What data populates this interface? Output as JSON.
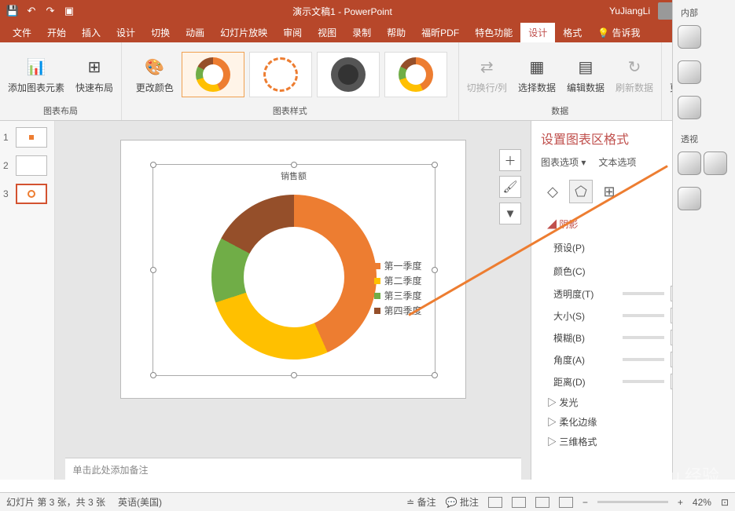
{
  "title": "演示文稿1 - PowerPoint",
  "user": "YuJiangLi",
  "tabs": {
    "file": "文件",
    "home": "开始",
    "insert": "插入",
    "design": "设计",
    "trans": "切换",
    "anim": "动画",
    "slideshow": "幻灯片放映",
    "review": "审阅",
    "view": "视图",
    "record": "录制",
    "help": "帮助",
    "foxit": "福昕PDF",
    "special": "特色功能",
    "chartdesign": "设计",
    "format": "格式",
    "tell": "告诉我"
  },
  "ribbon": {
    "group1": {
      "add": "添加图表元素",
      "quick": "快速布局",
      "label": "图表布局"
    },
    "group2": {
      "color": "更改颜色",
      "label": "图表样式"
    },
    "group3": {
      "switch": "切换行/列",
      "select": "选择数据",
      "edit": "编辑数据",
      "refresh": "刷新数据",
      "label": "数据"
    },
    "group4": {
      "type": "更改图表类型",
      "label": "类型"
    }
  },
  "thumbs": [
    {
      "n": "1"
    },
    {
      "n": "2"
    },
    {
      "n": "3"
    }
  ],
  "chart_data": {
    "type": "donut",
    "title": "销售额",
    "series": [
      {
        "name": "第一季度",
        "value": 43,
        "color": "#ed7d31"
      },
      {
        "name": "第二季度",
        "value": 27,
        "color": "#ffc000"
      },
      {
        "name": "第三季度",
        "value": 13,
        "color": "#70ad47"
      },
      {
        "name": "第四季度",
        "value": 17,
        "color": "#954f2a"
      }
    ]
  },
  "notes": "单击此处添加备注",
  "format_pane": {
    "title": "设置图表区格式",
    "opt1": "图表选项",
    "opt2": "文本选项",
    "shadow": "阴影",
    "preset": "预设(P)",
    "color": "颜色(C)",
    "trans": "透明度(T)",
    "size": "大小(S)",
    "blur": "模糊(B)",
    "angle": "角度(A)",
    "dist": "距离(D)",
    "glow": "发光",
    "soft": "柔化边缘",
    "threed": "三维格式"
  },
  "right_pane": {
    "inner": "内部",
    "persp": "透视"
  },
  "status": {
    "slide": "幻灯片 第 3 张，共 3 张",
    "lang": "英语(美国)",
    "notes": "备注",
    "comments": "批注",
    "zoom": "42%"
  },
  "watermark": "Baidu 经验"
}
